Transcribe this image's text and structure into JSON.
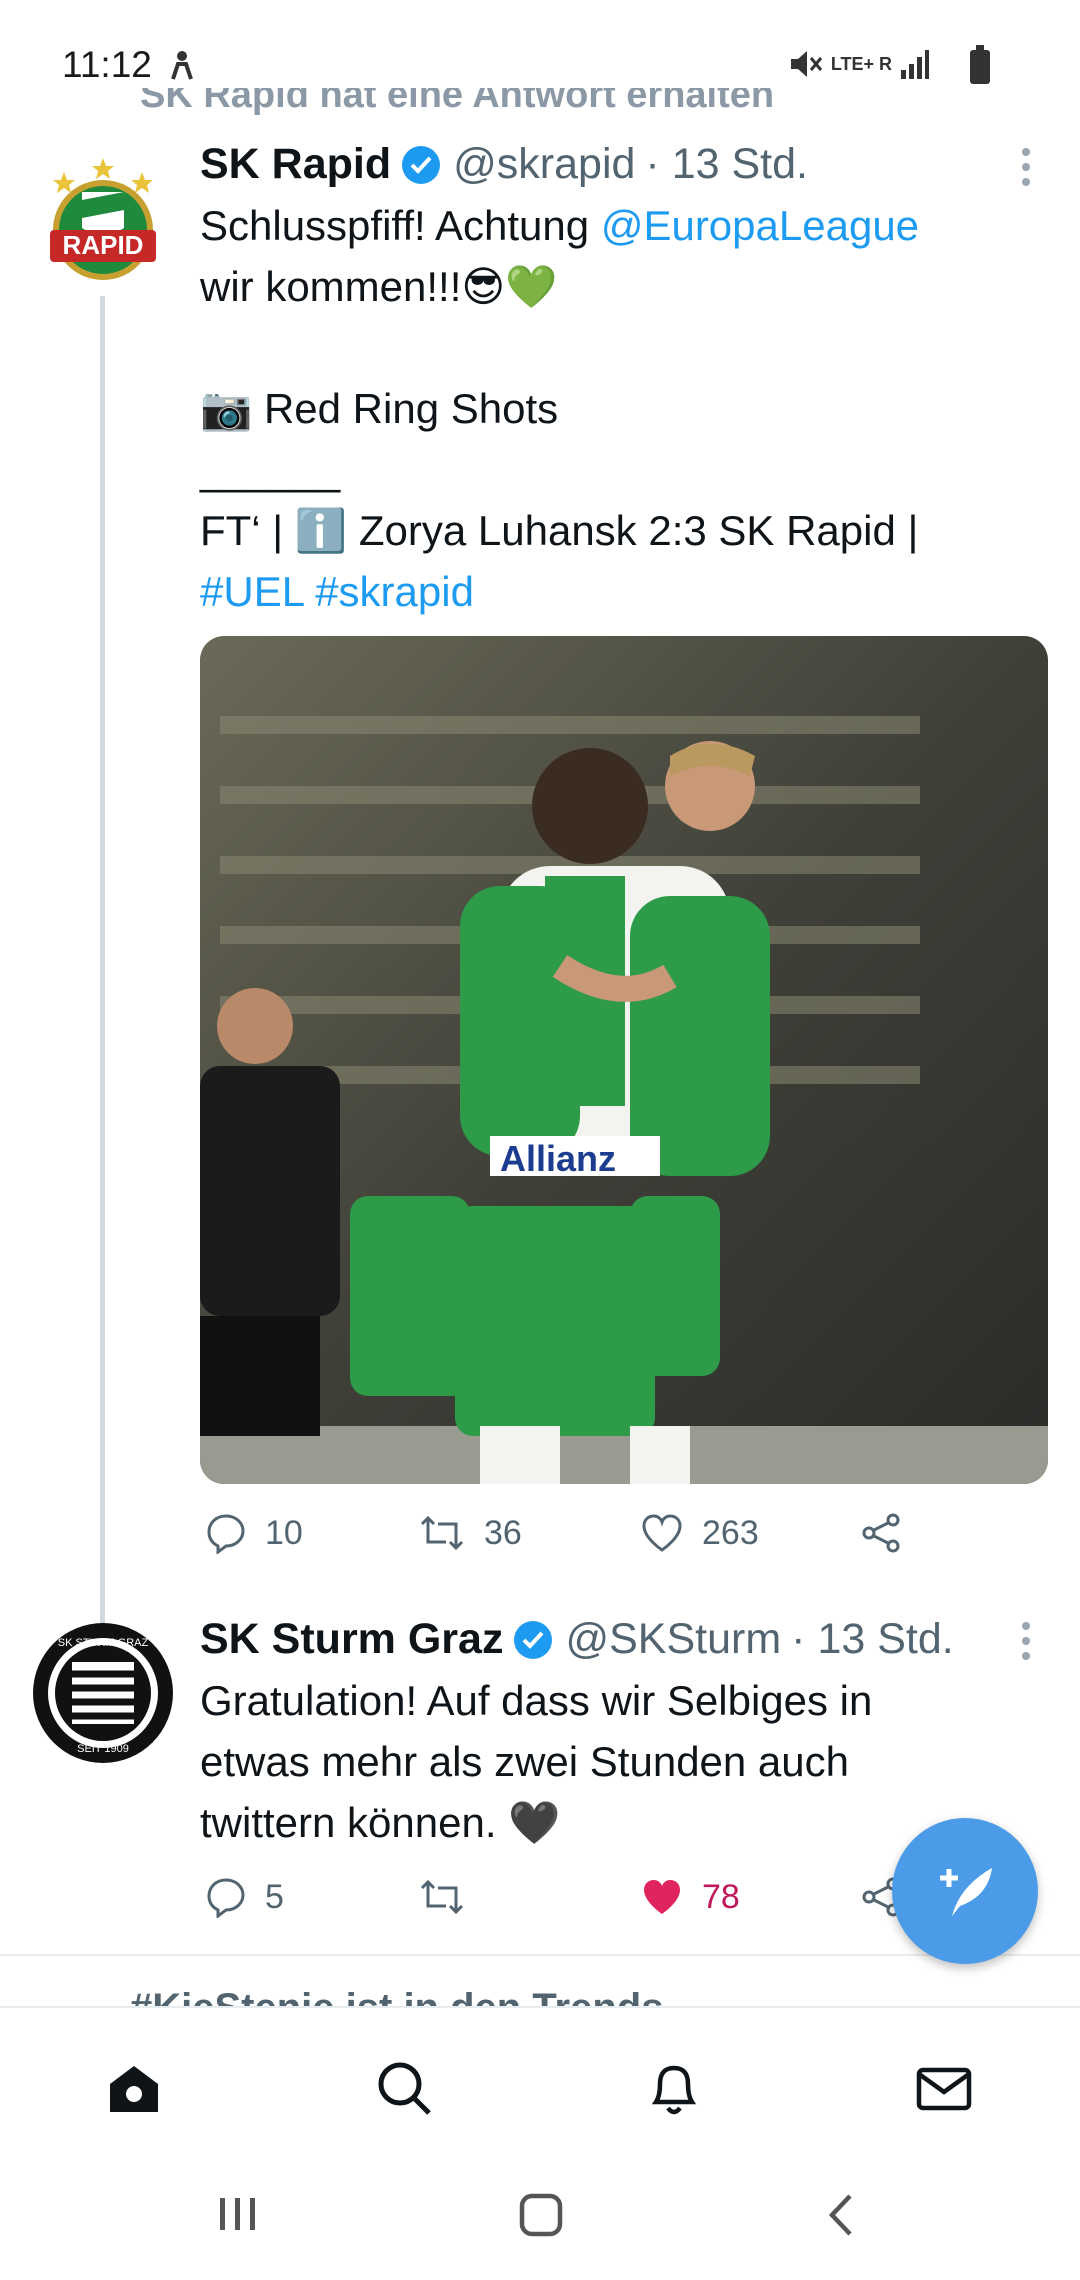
{
  "status_bar": {
    "time": "11:12",
    "network": "LTE+ R"
  },
  "context": {
    "text": "SK Rapid hat eine Antwort erhalten"
  },
  "tweet1": {
    "name": "SK Rapid",
    "handle": "@skrapid",
    "time": "· 13 Std.",
    "text_line1_prefix": "Schlusspfiff! Achtung ",
    "mention": "@EuropaLeague",
    "text_line2": "wir kommen!!!😎💚",
    "text_line3": "📷 Red Ring Shots",
    "text_line4": "______",
    "text_line5": "FT‘ | ℹ️ Zorya Luhansk 2:3 SK Rapid |",
    "hashtag1": "#UEL",
    "hashtag2": "#skrapid",
    "avatar_text": "RAPID",
    "replies": "10",
    "retweets": "36",
    "likes": "263"
  },
  "tweet2": {
    "name": "SK Sturm Graz",
    "handle": "@SKSturm",
    "time": "· 13 Std.",
    "text_line1": "Gratulation! Auf dass wir Selbiges in",
    "text_line2": "etwas mehr als zwei Stunden auch",
    "text_line3": "twittern können. 🖤",
    "avatar_text_top": "SK STURM GRAZ",
    "avatar_text_bottom": "SEIT 1909",
    "replies": "5",
    "likes": "78"
  },
  "trend_teaser": {
    "text": "#KieStenie ist in den Trends"
  },
  "colors": {
    "accent": "#1d9bf0",
    "like": "#e0245e",
    "fab": "#4c9be8",
    "rapid_green": "#1f8a3b"
  },
  "nav": {
    "items": [
      "home-icon",
      "search-icon",
      "bell-icon",
      "mail-icon"
    ]
  }
}
